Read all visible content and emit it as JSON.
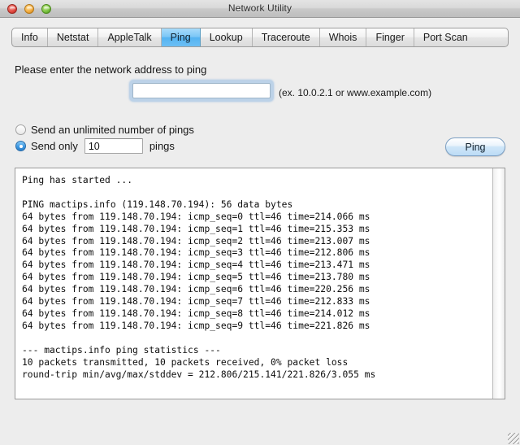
{
  "window": {
    "title": "Network Utility",
    "controls": {
      "close": "close-button",
      "minimize": "minimize-button",
      "zoom": "zoom-button"
    }
  },
  "tabs": {
    "selected": "Ping",
    "items": [
      {
        "label": "Info",
        "selected": false
      },
      {
        "label": "Netstat",
        "selected": false
      },
      {
        "label": "AppleTalk",
        "selected": false
      },
      {
        "label": "Ping",
        "selected": true
      },
      {
        "label": "Lookup",
        "selected": false
      },
      {
        "label": "Traceroute",
        "selected": false
      },
      {
        "label": "Whois",
        "selected": false
      },
      {
        "label": "Finger",
        "selected": false
      },
      {
        "label": "Port Scan",
        "selected": false
      }
    ]
  },
  "form": {
    "prompt": "Please enter the network address to ping",
    "address": {
      "value": "",
      "placeholder": "",
      "focused": true
    },
    "address_hint": "(ex. 10.0.2.1 or www.example.com)",
    "radio_unlimited": {
      "label": "Send an unlimited number of pings",
      "selected": false
    },
    "radio_only": {
      "label_before": "Send only",
      "label_after": "pings",
      "count_value": "10",
      "selected": true
    },
    "ping_button": "Ping"
  },
  "output": {
    "text": "Ping has started ...\n\nPING mactips.info (119.148.70.194): 56 data bytes\n64 bytes from 119.148.70.194: icmp_seq=0 ttl=46 time=214.066 ms\n64 bytes from 119.148.70.194: icmp_seq=1 ttl=46 time=215.353 ms\n64 bytes from 119.148.70.194: icmp_seq=2 ttl=46 time=213.007 ms\n64 bytes from 119.148.70.194: icmp_seq=3 ttl=46 time=212.806 ms\n64 bytes from 119.148.70.194: icmp_seq=4 ttl=46 time=213.471 ms\n64 bytes from 119.148.70.194: icmp_seq=5 ttl=46 time=213.780 ms\n64 bytes from 119.148.70.194: icmp_seq=6 ttl=46 time=220.256 ms\n64 bytes from 119.148.70.194: icmp_seq=7 ttl=46 time=212.833 ms\n64 bytes from 119.148.70.194: icmp_seq=8 ttl=46 time=214.012 ms\n64 bytes from 119.148.70.194: icmp_seq=9 ttl=46 time=221.826 ms\n\n--- mactips.info ping statistics ---\n10 packets transmitted, 10 packets received, 0% packet loss\nround-trip min/avg/max/stddev = 212.806/215.141/221.826/3.055 ms",
    "host": "mactips.info",
    "ip": "119.148.70.194",
    "data_bytes": "56",
    "replies": [
      {
        "icmp_seq": "0",
        "ttl": "46",
        "time_ms": "214.066"
      },
      {
        "icmp_seq": "1",
        "ttl": "46",
        "time_ms": "215.353"
      },
      {
        "icmp_seq": "2",
        "ttl": "46",
        "time_ms": "213.007"
      },
      {
        "icmp_seq": "3",
        "ttl": "46",
        "time_ms": "212.806"
      },
      {
        "icmp_seq": "4",
        "ttl": "46",
        "time_ms": "213.471"
      },
      {
        "icmp_seq": "5",
        "ttl": "46",
        "time_ms": "213.780"
      },
      {
        "icmp_seq": "6",
        "ttl": "46",
        "time_ms": "220.256"
      },
      {
        "icmp_seq": "7",
        "ttl": "46",
        "time_ms": "212.833"
      },
      {
        "icmp_seq": "8",
        "ttl": "46",
        "time_ms": "214.012"
      },
      {
        "icmp_seq": "9",
        "ttl": "46",
        "time_ms": "221.826"
      }
    ],
    "statistics": {
      "packets_transmitted": "10",
      "packets_received": "10",
      "packet_loss": "0%",
      "min_ms": "212.806",
      "avg_ms": "215.141",
      "max_ms": "221.826",
      "stddev_ms": "3.055"
    }
  },
  "colors": {
    "selected_tab": "#54b3f2",
    "focus_ring": "#7aaee2",
    "window_chrome": "#ededed",
    "close_light": "#e0463d",
    "minimize_light": "#f2a93b",
    "zoom_light": "#76bf3c"
  }
}
